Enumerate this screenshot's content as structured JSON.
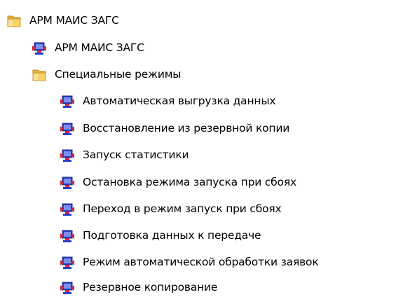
{
  "tree": {
    "root": {
      "label": "АРМ МАИС ЗАГС",
      "icon": "folder-icon"
    },
    "app_shortcut": {
      "label": "АРМ МАИС ЗАГС",
      "icon": "app-shortcut-icon"
    },
    "special_modes_folder": {
      "label": "Специальные режимы",
      "icon": "folder-icon"
    },
    "special_modes_items": [
      {
        "label": "Автоматическая выгрузка данных",
        "icon": "app-shortcut-icon"
      },
      {
        "label": "Восстановление из резервной копии",
        "icon": "app-shortcut-icon"
      },
      {
        "label": "Запуск статистики",
        "icon": "app-shortcut-icon"
      },
      {
        "label": "Остановка режима запуска при сбоях",
        "icon": "app-shortcut-icon"
      },
      {
        "label": "Переход в режим запуск при сбоях",
        "icon": "app-shortcut-icon"
      },
      {
        "label": "Подготовка данных к передаче",
        "icon": "app-shortcut-icon"
      },
      {
        "label": "Режим автоматической обработки заявок",
        "icon": "app-shortcut-icon"
      },
      {
        "label": "Резервное копирование",
        "icon": "app-shortcut-icon"
      }
    ]
  },
  "colors": {
    "folder_yellow": "#f0c24f",
    "shortcut_blue": "#2c3ec6",
    "shortcut_red": "#d8252a"
  }
}
